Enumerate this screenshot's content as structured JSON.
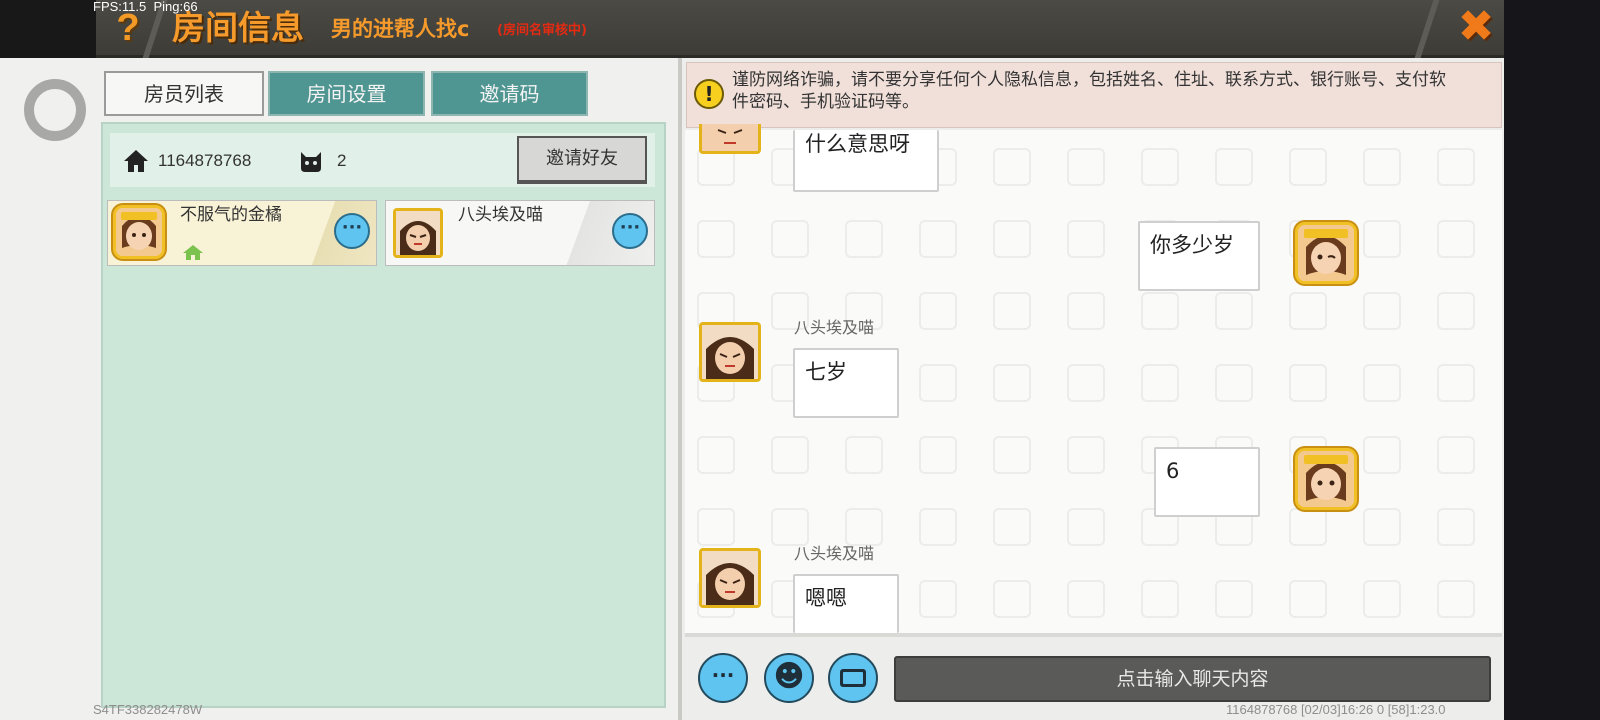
{
  "debug": "FPS:11.5  Ping:66",
  "header": {
    "help_glyph": "?",
    "title": "房间信息",
    "room_name": "男的进帮人找c",
    "review_status": "(房间名审核中)",
    "close_glyph": "✖"
  },
  "tabs": [
    {
      "label": "房员列表",
      "active": true
    },
    {
      "label": "房间设置",
      "active": false
    },
    {
      "label": "邀请码",
      "active": false
    }
  ],
  "room_info": {
    "room_id": "1164878768",
    "member_count": "2",
    "invite_button": "邀请好友"
  },
  "members": [
    {
      "name": "不服气的金橘",
      "is_owner": true,
      "more_glyph": "···"
    },
    {
      "name": "八头埃及喵",
      "is_owner": false,
      "more_glyph": "···"
    }
  ],
  "warning": {
    "icon_glyph": "!",
    "text": "谨防网络诈骗，请不要分享任何个人隐私信息，包括姓名、住址、联系方式、银行账号、支付软件密码、手机验证码等。"
  },
  "chat": {
    "messages": [
      {
        "side": "left",
        "sender": "",
        "text": "什么意思呀"
      },
      {
        "side": "right",
        "sender": "",
        "text": "你多少岁"
      },
      {
        "side": "left",
        "sender": "八头埃及喵",
        "text": "七岁"
      },
      {
        "side": "right",
        "sender": "",
        "text": "6"
      },
      {
        "side": "left",
        "sender": "八头埃及喵",
        "text": "嗯嗯"
      }
    ],
    "input_placeholder": "点击输入聊天内容",
    "more_glyph": "···",
    "emoji_glyph": "☻"
  },
  "footer": {
    "left": "S4TF338282478W",
    "right": "1164878768    [02/03]16:26 0    [58]1:23.0"
  },
  "colors": {
    "accent_orange": "#f59a2b",
    "teal_tab": "#4f9591",
    "panel_green": "#cce6d8",
    "button_blue": "#5fc4ef",
    "warning_red": "#e52a12"
  }
}
